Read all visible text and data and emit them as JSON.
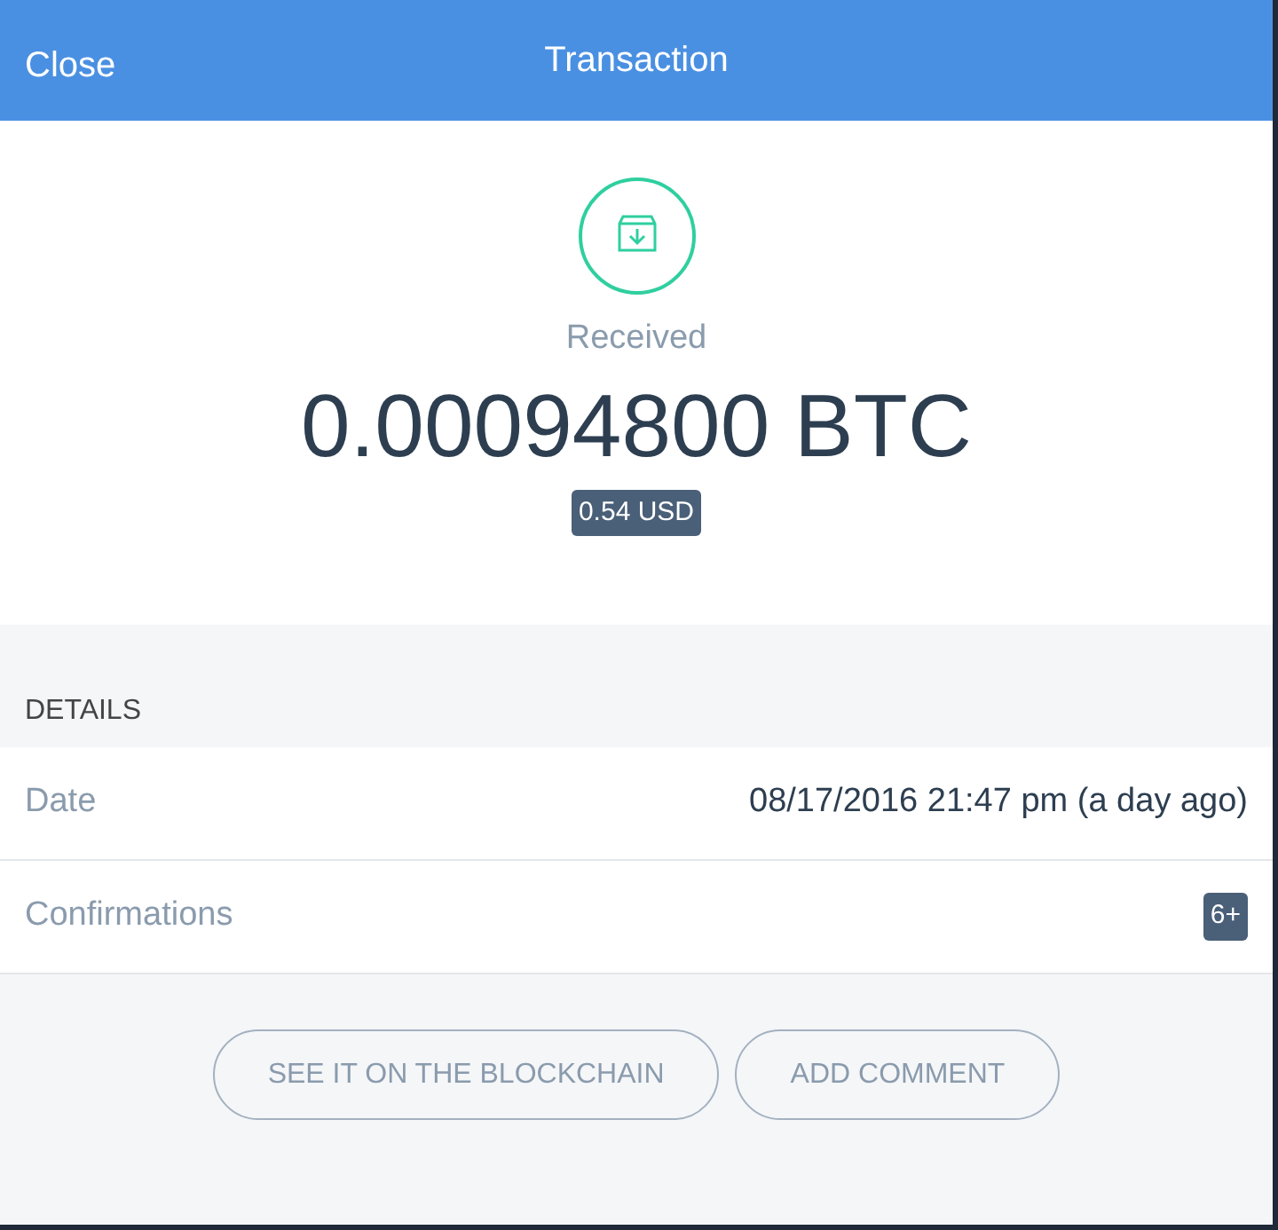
{
  "header": {
    "close": "Close",
    "title": "Transaction"
  },
  "summary": {
    "status": "Received",
    "amount": "0.00094800 BTC",
    "fiat": "0.54 USD"
  },
  "details": {
    "heading": "DETAILS",
    "rows": [
      {
        "label": "Date",
        "kind": "text",
        "value": "08/17/2016 21:47 pm (a day ago)"
      },
      {
        "label": "Confirmations",
        "kind": "badge",
        "value": "6+"
      }
    ]
  },
  "buttons": [
    "SEE IT ON THE BLOCKCHAIN",
    "ADD COMMENT"
  ]
}
